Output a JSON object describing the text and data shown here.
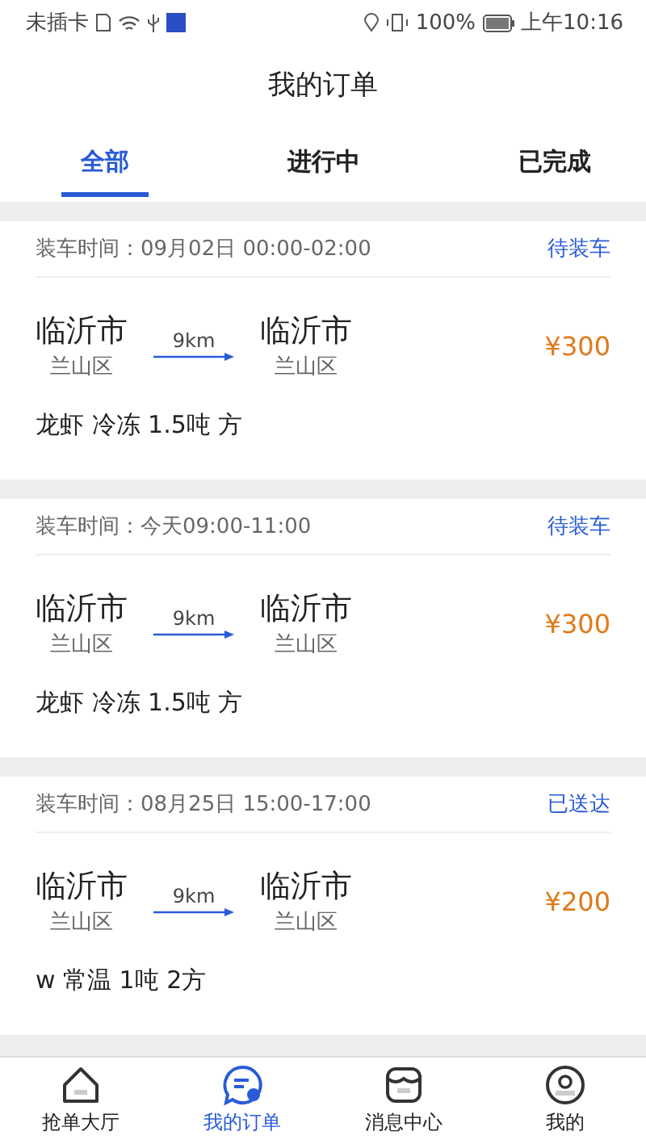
{
  "status_bar": {
    "carrier": "未插卡",
    "battery": "100%",
    "time": "上午10:16"
  },
  "title": "我的订单",
  "tabs": [
    {
      "label": "全部",
      "selected": true
    },
    {
      "label": "进行中",
      "selected": false
    },
    {
      "label": "已完成",
      "selected": false
    }
  ],
  "orders": [
    {
      "time_label": "装车时间：",
      "time": "09月02日 00:00-02:00",
      "status": "待装车",
      "from_city": "临沂市",
      "from_district": "兰山区",
      "distance": "9km",
      "to_city": "临沂市",
      "to_district": "兰山区",
      "price": "¥300",
      "cargo": "龙虾 冷冻 1.5吨 方"
    },
    {
      "time_label": "装车时间：",
      "time": "今天09:00-11:00",
      "status": "待装车",
      "from_city": "临沂市",
      "from_district": "兰山区",
      "distance": "9km",
      "to_city": "临沂市",
      "to_district": "兰山区",
      "price": "¥300",
      "cargo": "龙虾 冷冻 1.5吨 方"
    },
    {
      "time_label": "装车时间：",
      "time": "08月25日 15:00-17:00",
      "status": "已送达",
      "from_city": "临沂市",
      "from_district": "兰山区",
      "distance": "9km",
      "to_city": "临沂市",
      "to_district": "兰山区",
      "price": "¥200",
      "cargo": "w 常温 1吨 2方"
    }
  ],
  "nav": [
    {
      "kind": "home",
      "label": "抢单大厅",
      "selected": false
    },
    {
      "kind": "orders",
      "label": "我的订单",
      "selected": true
    },
    {
      "kind": "messages",
      "label": "消息中心",
      "selected": false
    },
    {
      "kind": "profile",
      "label": "我的",
      "selected": false
    }
  ]
}
